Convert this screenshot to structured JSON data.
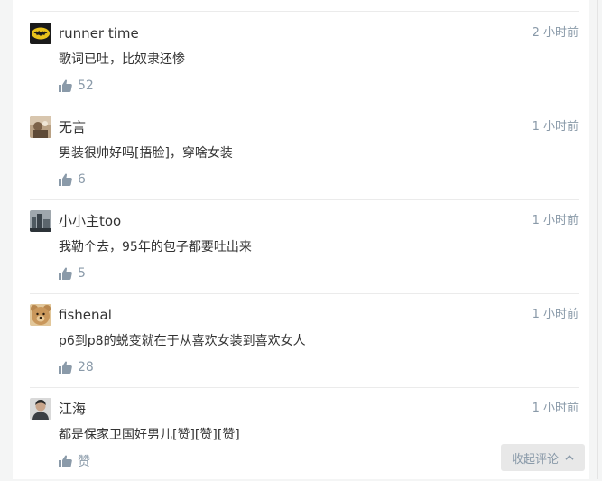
{
  "comments": [
    {
      "author": "runner time",
      "time": "2 小时前",
      "content": "歌词已吐，比奴隶还惨",
      "likes": "52",
      "avatar": "batman-logo-avatar"
    },
    {
      "author": "无言",
      "time": "1 小时前",
      "content": "男装很帅好吗[捂脸]，穿啥女装",
      "likes": "6",
      "avatar": "photo-avatar"
    },
    {
      "author": "小小主too",
      "time": "1 小时前",
      "content": "我勒个去，95年的包子都要吐出来",
      "likes": "5",
      "avatar": "city-photo-avatar"
    },
    {
      "author": "fishenal",
      "time": "1 小时前",
      "content": "p6到p8的蜕变就在于从喜欢女装到喜欢女人",
      "likes": "28",
      "avatar": "teddy-bear-avatar"
    },
    {
      "author": "江海",
      "time": "1 小时前",
      "content": "都是保家卫国好男儿[赞][赞][赞]",
      "likes": "赞",
      "avatar": "person-photo-avatar"
    }
  ],
  "collapse_button": {
    "label": "收起评论",
    "icon": "chevron-up-icon"
  },
  "like_icon": "thumbs-up-icon",
  "colors": {
    "meta_gray": "#8a9aa9",
    "text": "#333333",
    "divider": "#ebebeb"
  }
}
